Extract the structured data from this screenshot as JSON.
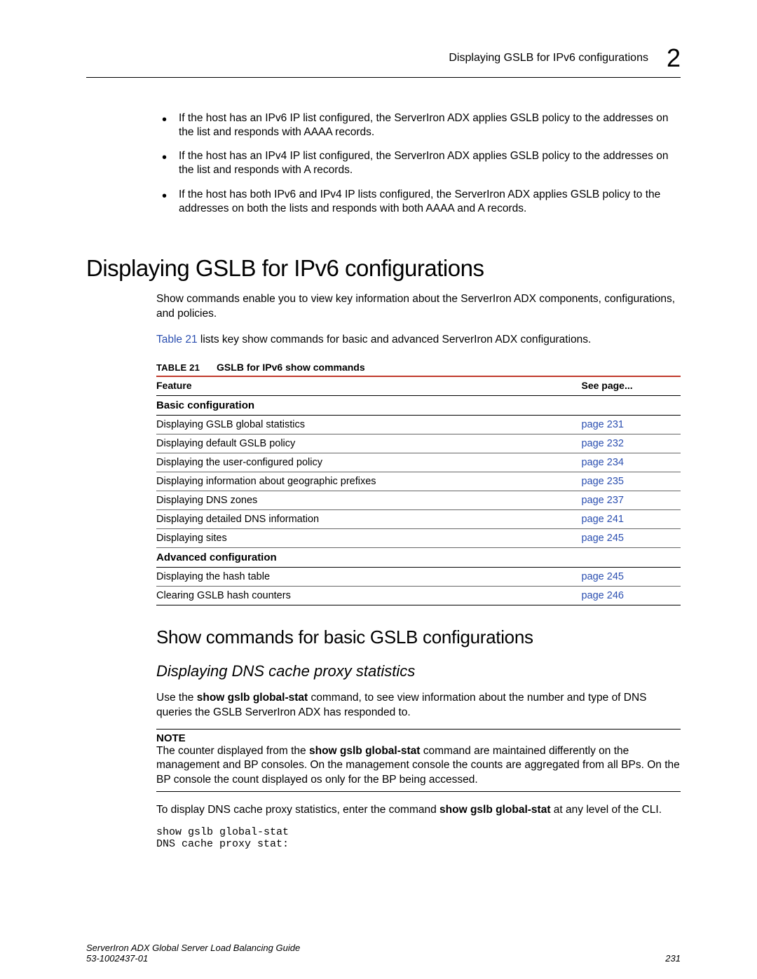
{
  "header": {
    "section": "Displaying GSLB for IPv6 configurations",
    "chapter": "2"
  },
  "bullets": [
    "If the host has an IPv6 IP list configured, the ServerIron ADX applies GSLB policy to the addresses on the list and responds with AAAA records.",
    "If the host has an IPv4 IP list configured, the ServerIron ADX applies GSLB policy to the addresses on the list and responds with A records.",
    "If the host has both IPv6 and IPv4 IP lists configured, the ServerIron ADX applies GSLB policy to the addresses on both the lists and responds with both AAAA and A records."
  ],
  "h1": "Displaying GSLB for IPv6 configurations",
  "intro": "Show commands enable you to view key information about the ServerIron ADX components, configurations, and policies.",
  "table_ref_link": "Table 21",
  "table_ref_rest": " lists key show commands for basic and advanced ServerIron ADX configurations.",
  "table": {
    "number": "TABLE 21",
    "title": "GSLB for IPv6 show commands",
    "head_feature": "Feature",
    "head_see": "See page...",
    "rows": [
      {
        "type": "section",
        "feature": "Basic configuration",
        "page": ""
      },
      {
        "type": "row",
        "feature": "Displaying GSLB global statistics",
        "page": "page 231"
      },
      {
        "type": "row",
        "feature": "Displaying default GSLB policy",
        "page": "page 232"
      },
      {
        "type": "row",
        "feature": "Displaying the user-configured policy",
        "page": "page 234"
      },
      {
        "type": "row",
        "feature": "Displaying information about geographic prefixes",
        "page": "page 235"
      },
      {
        "type": "row",
        "feature": "Displaying DNS zones",
        "page": "page 237"
      },
      {
        "type": "row",
        "feature": "Displaying detailed DNS information",
        "page": "page 241"
      },
      {
        "type": "row",
        "feature": "Displaying sites",
        "page": "page 245"
      },
      {
        "type": "section",
        "feature": "Advanced configuration",
        "page": ""
      },
      {
        "type": "row",
        "feature": "Displaying the hash table",
        "page": "page 245"
      },
      {
        "type": "row",
        "feature": "Clearing GSLB hash counters",
        "page": "page 246",
        "last": true
      }
    ]
  },
  "h2": "Show commands for basic GSLB configurations",
  "h3": "Displaying DNS cache proxy statistics",
  "para1_pre": "Use the ",
  "para1_cmd": "show gslb global-stat",
  "para1_post": " command, to see view information about the number and type of DNS queries the GSLB ServerIron ADX has responded to.",
  "note": {
    "label": "NOTE",
    "body_pre": "The counter displayed from the ",
    "body_cmd": "show gslb global-stat",
    "body_post": " command are maintained differently on the management and BP consoles. On the management console the counts are aggregated from all BPs. On the BP console the count displayed os only for the BP being accessed."
  },
  "para2_pre": "To display DNS cache proxy statistics, enter the command ",
  "para2_cmd": "show gslb global-stat",
  "para2_post": " at any level of the CLI.",
  "code": "show gslb global-stat\nDNS cache proxy stat:",
  "footer": {
    "left1": "ServerIron ADX Global Server Load Balancing Guide",
    "left2": "53-1002437-01",
    "right": "231"
  }
}
